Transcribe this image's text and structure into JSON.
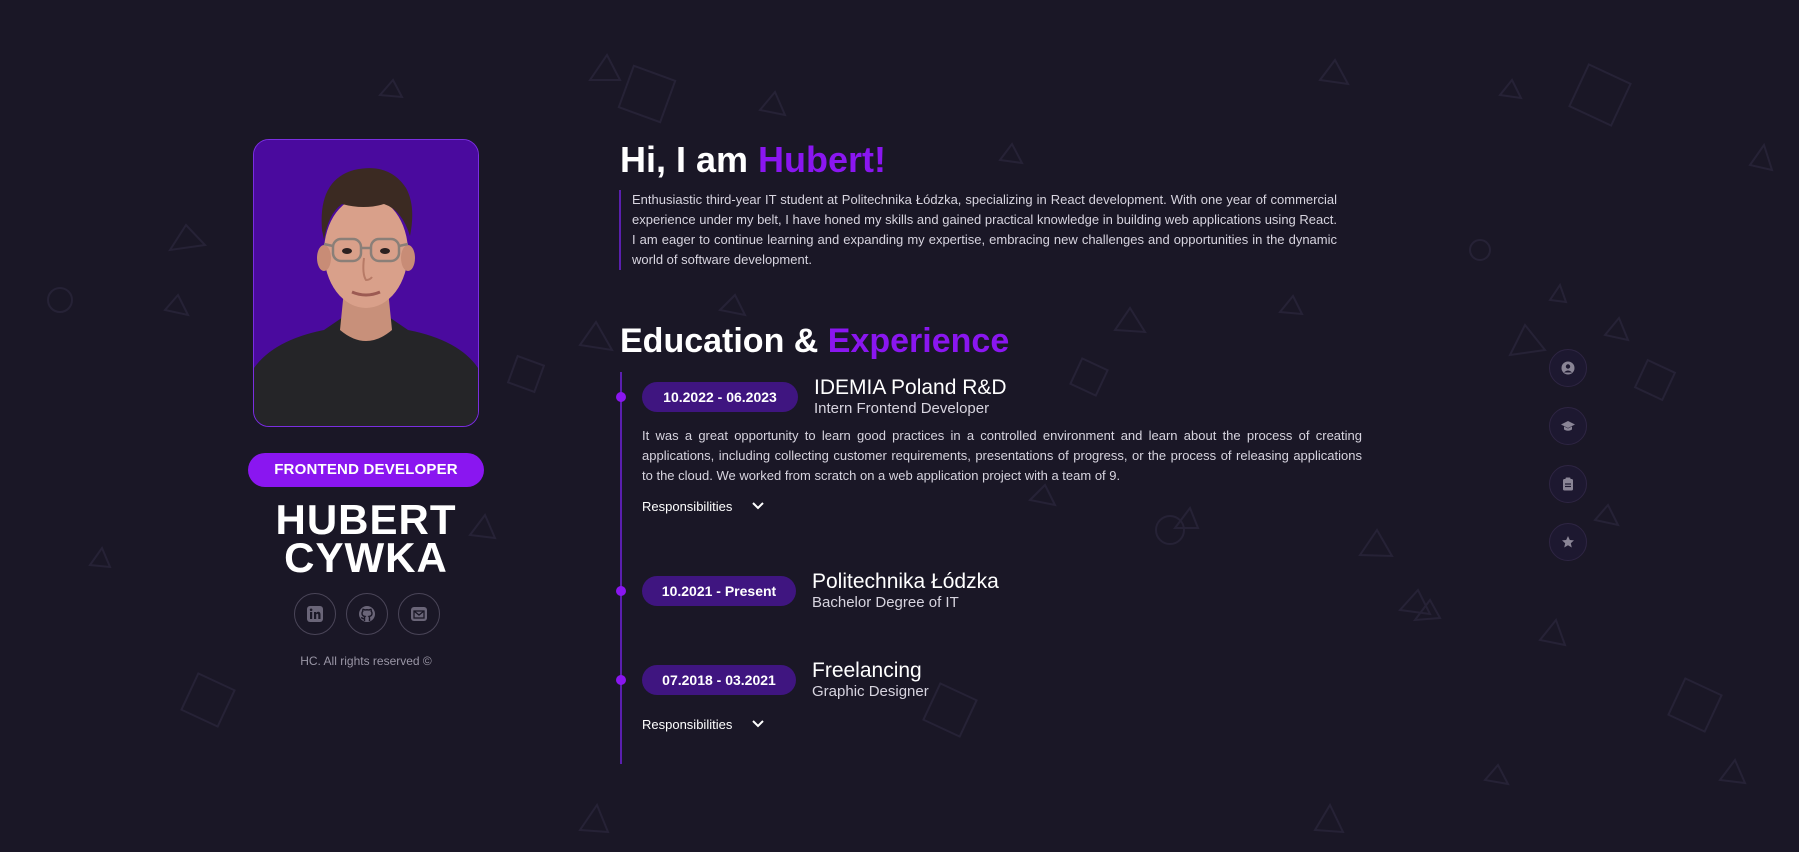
{
  "profile": {
    "role": "FRONTEND DEVELOPER",
    "first_name": "HUBERT",
    "last_name": "CYWKA",
    "photo_alt": "Profile photo",
    "socials": [
      {
        "icon": "linkedin-icon"
      },
      {
        "icon": "github-icon"
      },
      {
        "icon": "mail-icon"
      }
    ],
    "copyright": "HC. All rights reserved ©"
  },
  "hero": {
    "greeting": "Hi, I am ",
    "name": "Hubert!",
    "about": "Enthusiastic third-year IT student at Politechnika Łódzka, specializing in React development. With one year of commercial experience under my belt, I have honed my skills and gained practical knowledge in building web applications using React. I am eager to continue learning and expanding my expertise, embracing new challenges and opportunities in the dynamic world of software development."
  },
  "section": {
    "title_start": "Education & ",
    "title_accent": "Experience"
  },
  "timeline": [
    {
      "date": "10.2022 - 06.2023",
      "org": "IDEMIA Poland R&D",
      "role": "Intern Frontend Developer",
      "description": "It was a great opportunity to learn good practices in a controlled environment and learn about the process of creating applications, including collecting customer requirements, presentations of progress, or the process of releasing applications to the cloud. We worked from scratch on a web application project with a team of 9.",
      "toggle": "Responsibilities"
    },
    {
      "date": "10.2021 - Present",
      "org": "Politechnika Łódzka",
      "role": "Bachelor Degree of IT"
    },
    {
      "date": "07.2018 - 03.2021",
      "org": "Freelancing",
      "role": "Graphic Designer",
      "toggle": "Responsibilities"
    }
  ],
  "side_nav": [
    {
      "icon": "user-icon"
    },
    {
      "icon": "graduation-cap-icon"
    },
    {
      "icon": "clipboard-icon"
    },
    {
      "icon": "star-icon"
    }
  ],
  "colors": {
    "background": "#1a1726",
    "accent": "#8a16f0",
    "pill": "#3f1580",
    "photo_bg": "#4a0a9e"
  }
}
